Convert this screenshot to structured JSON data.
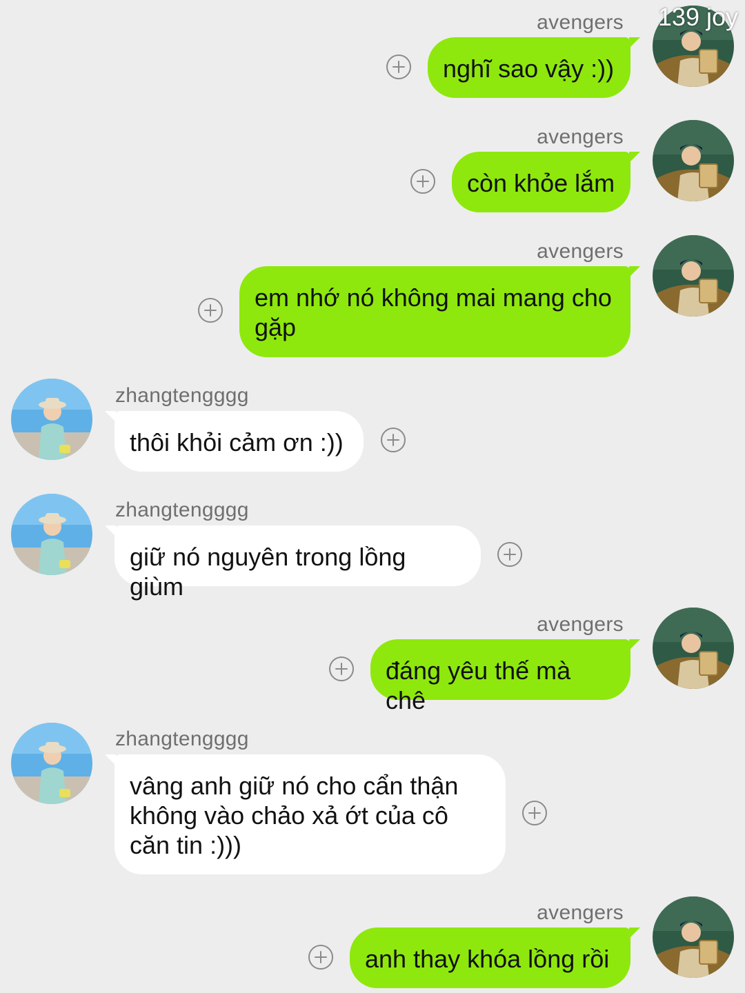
{
  "watermark": "139 joy",
  "colors": {
    "outgoing_bubble": "#8ee80d",
    "incoming_bubble": "#ffffff",
    "background": "#ededed"
  },
  "messages": [
    {
      "sender": "avengers",
      "direction": "out",
      "text": "nghĩ sao vậy :))",
      "avatar": "avatar-avengers"
    },
    {
      "sender": "avengers",
      "direction": "out",
      "text": "còn khỏe lắm",
      "avatar": "avatar-avengers"
    },
    {
      "sender": "avengers",
      "direction": "out",
      "text": "em nhớ nó không mai mang cho gặp",
      "avatar": "avatar-avengers"
    },
    {
      "sender": "zhangtengggg",
      "direction": "in",
      "text": "thôi khỏi cảm ơn :))",
      "avatar": "avatar-zhangtengggg"
    },
    {
      "sender": "zhangtengggg",
      "direction": "in",
      "text": "giữ nó nguyên trong lồng giùm",
      "avatar": "avatar-zhangtengggg"
    },
    {
      "sender": "avengers",
      "direction": "out",
      "text": "đáng yêu thế mà chê",
      "avatar": "avatar-avengers"
    },
    {
      "sender": "zhangtengggg",
      "direction": "in",
      "text": "vâng anh giữ nó cho cẩn thận không vào chảo xả ớt của cô căn tin :)))",
      "avatar": "avatar-zhangtengggg"
    },
    {
      "sender": "avengers",
      "direction": "out",
      "text": "anh thay khóa lồng rồi",
      "avatar": "avatar-avengers"
    }
  ]
}
